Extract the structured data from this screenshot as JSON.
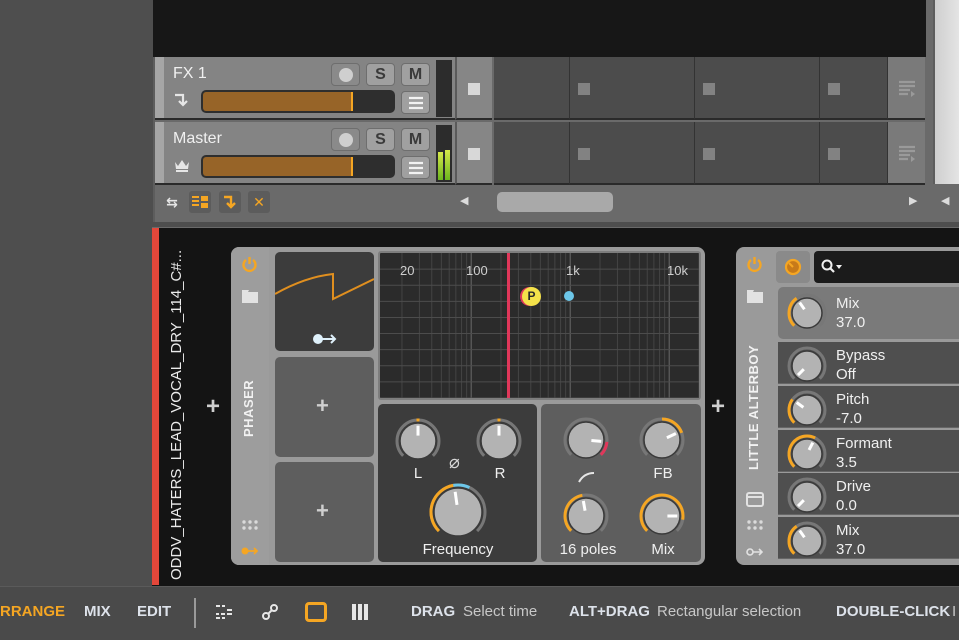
{
  "colors": {
    "accent": "#f5a623",
    "track_red": "#e3473a",
    "fader_fill": "#976428",
    "modulation_blue": "#6cc6e8",
    "pink_line": "#e0375a"
  },
  "tracks": [
    {
      "name": "FX 1",
      "icon": "fx-return-icon",
      "record_label": "",
      "solo_label": "S",
      "mute_label": "M",
      "volume_fraction": 0.78,
      "meter_level": 0
    },
    {
      "name": "Master",
      "icon": "crown-icon",
      "record_label": "",
      "solo_label": "S",
      "mute_label": "M",
      "volume_fraction": 0.78,
      "meter_level": 0.5
    }
  ],
  "arranger_toolbar": {
    "buttons": [
      "swap-icon",
      "layout-icon",
      "fx-return-icon",
      "close-icon"
    ],
    "scroll_left": "◀",
    "scroll_right": "▶",
    "scroll_left_2": "◀"
  },
  "device_chain": {
    "track_name": "ODDV_HATERS_LEAD_VOCAL_DRY_114_C#...",
    "add_label": "+"
  },
  "phaser": {
    "title": "PHASER",
    "freq_ticks": [
      "20",
      "100",
      "1k",
      "10k"
    ],
    "marker_label": "P",
    "knobs": {
      "L": "L",
      "R": "R",
      "frequency": "Frequency",
      "shape": "",
      "fb": "FB",
      "poles": "16 poles",
      "mix": "Mix"
    },
    "phase_symbol": "⌀",
    "modulator_add": "+"
  },
  "little_alterboy": {
    "title": "LITTLE ALTERBOY",
    "search_placeholder": "",
    "params": [
      {
        "name": "Mix",
        "value": "37.0",
        "fraction": 0.37
      },
      {
        "name": "Bypass",
        "value": "Off",
        "fraction": 0.0
      },
      {
        "name": "Pitch",
        "value": "-7.0",
        "fraction": 0.3
      },
      {
        "name": "Formant",
        "value": "3.5",
        "fraction": 0.6
      },
      {
        "name": "Drive",
        "value": "0.0",
        "fraction": 0.0
      },
      {
        "name": "Mix",
        "value": "37.0",
        "fraction": 0.37
      }
    ]
  },
  "bottom_bar": {
    "modes": [
      "RRANGE",
      "MIX",
      "EDIT"
    ],
    "active_mode": "RRANGE",
    "hints": [
      {
        "key": "DRAG",
        "action": "Select time"
      },
      {
        "key": "ALT+DRAG",
        "action": "Rectangular selection"
      },
      {
        "key": "DOUBLE-CLICK",
        "action": "I"
      }
    ]
  }
}
